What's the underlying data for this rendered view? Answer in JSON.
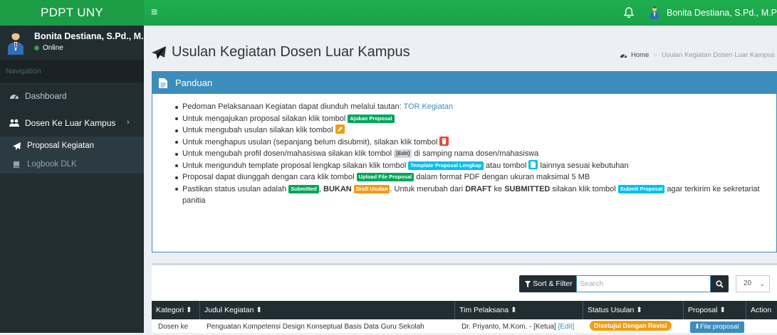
{
  "brand": "PDPT UNY",
  "topbar": {
    "menu_glyph": "≡",
    "user_name": "Bonita Destiana, S.Pd., M.Pd."
  },
  "sidebar": {
    "user_name": "Bonita Destiana, S.Pd., M.P",
    "status": "Online",
    "nav_header": "Navigation",
    "items": [
      {
        "label": "Dashboard",
        "icon": "dashboard-icon"
      },
      {
        "label": "Dosen Ke Luar Kampus",
        "icon": "users-icon",
        "chevron": "›"
      }
    ],
    "subitems": [
      {
        "label": "Proposal Kegiatan",
        "icon": "send-icon",
        "active": true
      },
      {
        "label": "Logbook DLK",
        "icon": "book-icon",
        "active": false
      }
    ]
  },
  "page": {
    "title": "Usulan Kegiatan Dosen Luar Kampus",
    "breadcrumb_home": "Home",
    "breadcrumb_current": "Usulan Kegiatan Dosen Luar Kampus"
  },
  "guide": {
    "title": "Panduan",
    "l1_text": "Pedoman Pelaksanaan Kegiatan dapat diunduh melalui tautan: ",
    "l1_link": "TOR Kegiatan",
    "l2_text": "Untuk mengajukan proposal silakan klik tombol ",
    "l2_badge": "Ajukan Proposal",
    "l3_text": "Untuk mengubah usulan silakan klik tombol ",
    "l4_text": "Untuk menghapus usulan (sepanjang belum disubmit), silakan klik tombol ",
    "l5_text_a": "Untuk mengubah profil dosen/mahasiswa silakan klik tombol ",
    "l5_badge": "[Edit]",
    "l5_text_b": " di samping nama dosen/mahasiswa",
    "l6_text_a": "Untuk mengunduh template proposal lengkap silakan klik tombol ",
    "l6_badge": "Template Proposal Lengkap",
    "l6_text_b": " atau tombol ",
    "l6_text_c": " lainnya sesuai kebutuhan",
    "l7_text_a": "Proposal dapat diunggah dengan cara klik tombol ",
    "l7_badge": "Upload File Proposal",
    "l7_text_b": " dalam format PDF dengan ukuran maksimal 5 MB",
    "l8_text_a": "Pastikan status usulan adalah ",
    "l8_badge_submitted": "Submitted",
    "l8_text_b": ", ",
    "l8_bukan": "BUKAN",
    "l8_text_c": " ",
    "l8_badge_draft": "Draft Usulan",
    "l8_text_d": ". Untuk merubah dari ",
    "l8_draft": "DRAFT",
    "l8_text_e": " ke ",
    "l8_submitted": "SUBMITTED",
    "l8_text_f": " silakan klik tombol ",
    "l8_badge_submit": "Submit Proposal",
    "l8_text_g": " agar terkirim ke sekretariat panitia"
  },
  "table": {
    "sort_label": "Sort & Filter",
    "search_placeholder": "Search",
    "per_page": "20",
    "columns": [
      "Kategori",
      "Judul Kegiatan",
      "Tim Pelaksana",
      "Status Usulan",
      "Proposal",
      "Action"
    ],
    "sort_glyph": "⬍",
    "row": {
      "kategori": "Dosen ke",
      "judul": "Penguatan Kompetensi Design Konseptual Basis Data Guru Sekolah",
      "tim": "Dr. Priyanto, M.Kom. - [Ketua]",
      "tim_edit": "[Edit]",
      "status": "Disetujui Dengan Revisi",
      "proposal": "File proposal"
    }
  },
  "colors": {
    "topbar": "#1fae4e",
    "sidebar": "#222d32",
    "box_header": "#3c8dbc",
    "badge_green": "#00a65a",
    "badge_orange": "#f39c12",
    "badge_red": "#dd4b39",
    "badge_blue": "#00c0ef"
  }
}
